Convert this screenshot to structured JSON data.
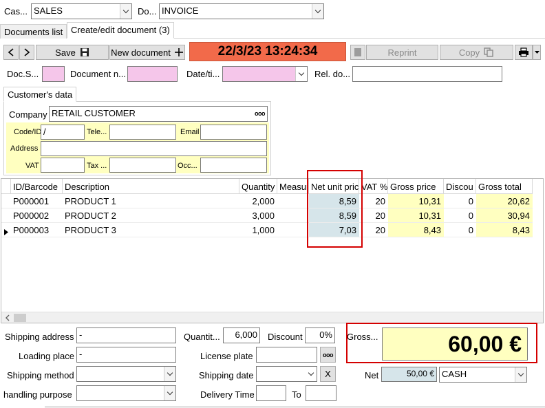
{
  "top": {
    "cash_label": "Cas...",
    "cash_value": "SALES",
    "doc_label": "Do...",
    "doc_value": "INVOICE"
  },
  "tabs": [
    "Documents list",
    "Create/edit document (3)"
  ],
  "toolbar": {
    "save_label": "Save",
    "new_document_label": "New document",
    "datetime": "22/3/23 13:24:34",
    "reprint_label": "Reprint",
    "copy_label": "Copy"
  },
  "doc_fields": {
    "doc_series_label": "Doc.S...",
    "doc_number_label": "Document n...",
    "date_label": "Date/ti...",
    "rel_doc_label": "Rel. do..."
  },
  "customer": {
    "tab_label": "Customer's data",
    "company_label": "Company",
    "company_value": "RETAIL CUSTOMER",
    "more_glyph": "ooo",
    "code_label": "Code/ID",
    "code_value": "/",
    "tele_label": "Tele...",
    "email_label": "Email",
    "address_label": "Address",
    "vat_label": "VAT",
    "tax_label": "Tax ...",
    "occ_label": "Occ..."
  },
  "table": {
    "columns": [
      "ID/Barcode",
      "Description",
      "Quantity",
      "Measur",
      "Net unit pric",
      "VAT %",
      "Gross price",
      "Discou",
      "Gross total"
    ],
    "rows": [
      {
        "id": "P000001",
        "desc": "PRODUCT 1",
        "qty": "2,000",
        "measure": "",
        "net": "8,59",
        "vat": "20",
        "gross": "10,31",
        "disc": "0",
        "total": "20,62",
        "current": false
      },
      {
        "id": "P000002",
        "desc": "PRODUCT 2",
        "qty": "3,000",
        "measure": "",
        "net": "8,59",
        "vat": "20",
        "gross": "10,31",
        "disc": "0",
        "total": "30,94",
        "current": false
      },
      {
        "id": "P000003",
        "desc": "PRODUCT 3",
        "qty": "1,000",
        "measure": "",
        "net": "7,03",
        "vat": "20",
        "gross": "8,43",
        "disc": "0",
        "total": "8,43",
        "current": true
      }
    ]
  },
  "bottom": {
    "shipping_address_label": "Shipping address",
    "shipping_address_value": "-",
    "loading_place_label": "Loading place",
    "loading_place_value": "-",
    "shipping_method_label": "Shipping method",
    "handling_purpose_label": "handling purpose",
    "quantity_label": "Quantit...",
    "quantity_value": "6,000",
    "discount_label": "Discount",
    "discount_value": "0%",
    "license_plate_label": "License plate",
    "shipping_date_label": "Shipping date",
    "delivery_time_label": "Delivery Time",
    "to_label": "To",
    "gross_label": "Gross...",
    "gross_value": "60,00 €",
    "net_label": "Net",
    "net_value": "50,00 €",
    "payment_value": "CASH",
    "clear_label": "X"
  },
  "colors": {
    "datetime_bg": "#f26a4a",
    "highlight_red": "#d40000",
    "field_pink": "#f5c6ea",
    "field_yellow": "#ffffc0",
    "net_blue": "#d6e5ea"
  }
}
